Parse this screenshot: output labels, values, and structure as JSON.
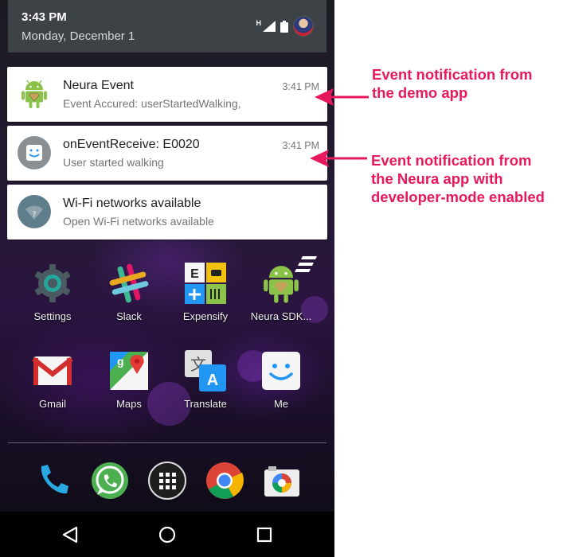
{
  "status_bar": {
    "time": "3:43 PM",
    "date": "Monday, December 1",
    "network": "H"
  },
  "notifications": [
    {
      "title": "Neura Event",
      "text": "Event Accured: userStartedWalking,",
      "time": "3:41 PM",
      "icon": "android-robot-icon"
    },
    {
      "title": "onEventReceive:  E0020",
      "text": "User started walking",
      "time": "3:41 PM",
      "icon": "smiley-app-icon"
    },
    {
      "title": "Wi-Fi networks available",
      "text": "Open Wi-Fi networks available",
      "time": "",
      "icon": "wifi-icon"
    }
  ],
  "home": {
    "row1": [
      {
        "label": "Settings",
        "icon": "gear-icon"
      },
      {
        "label": "Slack",
        "icon": "slack-icon"
      },
      {
        "label": "Expensify",
        "icon": "expensify-icon"
      },
      {
        "label": "Neura SDK...",
        "icon": "android-robot-icon"
      }
    ],
    "row2": [
      {
        "label": "Gmail",
        "icon": "gmail-icon"
      },
      {
        "label": "Maps",
        "icon": "maps-icon"
      },
      {
        "label": "Translate",
        "icon": "translate-icon"
      },
      {
        "label": "Me",
        "icon": "smiley-app-icon"
      }
    ],
    "dock": [
      "phone-icon",
      "whatsapp-icon",
      "app-drawer-icon",
      "chrome-icon",
      "camera-icon"
    ]
  },
  "navbar": [
    "back-icon",
    "home-icon",
    "recents-icon"
  ],
  "annotations": {
    "first": {
      "line1": "Event notification from",
      "line2": "the demo app"
    },
    "second": {
      "line1": "Event notification from",
      "line2": "the Neura app with",
      "line3": "developer-mode enabled"
    }
  },
  "colors": {
    "annotation": "#e8185c",
    "shade_header": "#3c4246"
  }
}
